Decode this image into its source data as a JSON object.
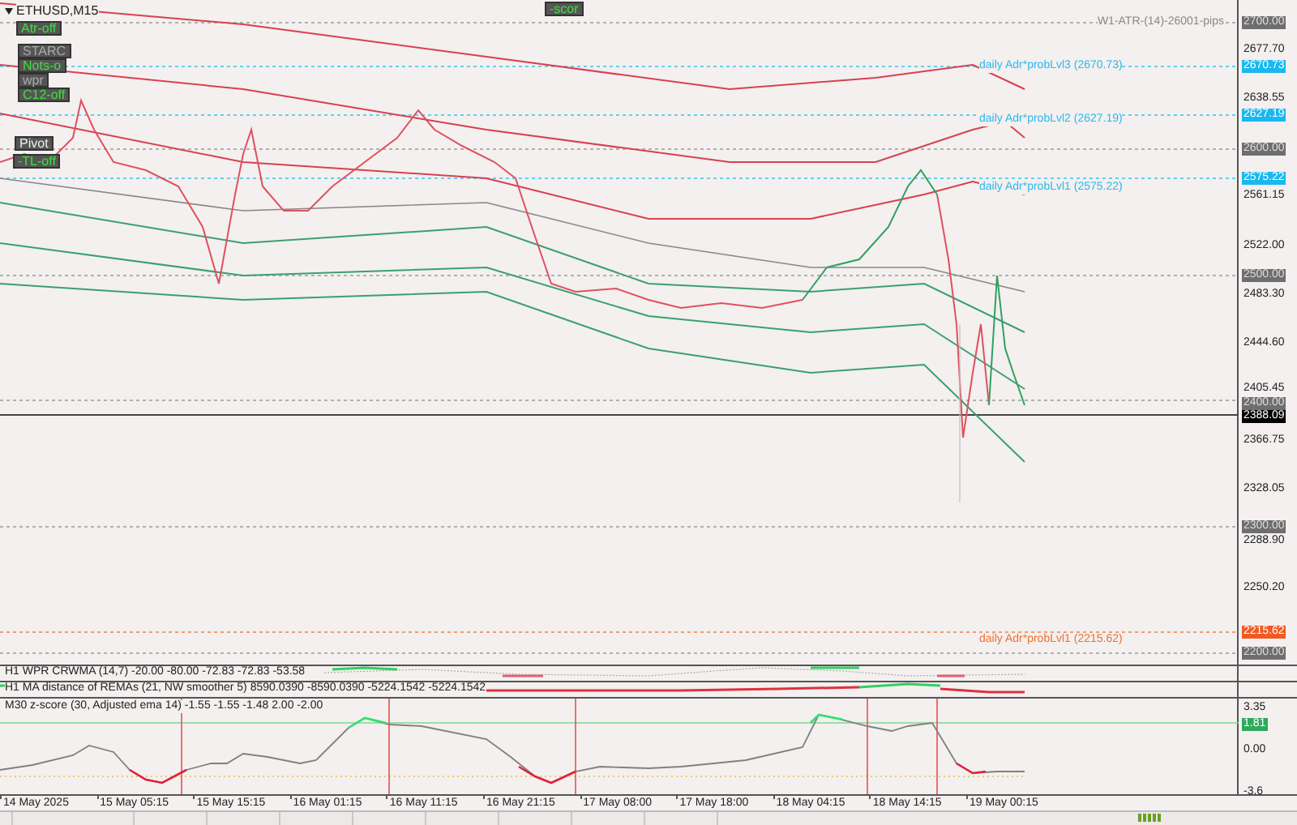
{
  "chart": {
    "symbol": "ETHUSD,M15",
    "buttons": [
      {
        "label": "Atr-off",
        "kind": "toggle"
      },
      {
        "label": "STARC",
        "kind": "caption"
      },
      {
        "label": "Nots-o",
        "kind": "toggle"
      },
      {
        "label": "wpr",
        "kind": "caption"
      },
      {
        "label": "C12-off",
        "kind": "toggle"
      },
      {
        "label": "Pivot",
        "kind": "button"
      },
      {
        "label": "-TL-off",
        "kind": "toggle"
      },
      {
        "label": "-scor",
        "kind": "toggle"
      }
    ],
    "level_labels": [
      {
        "text": "W1-ATR-(14)-26001-pips",
        "kind": "info"
      },
      {
        "text": "daily Adr*probLvl3 (2670.73)",
        "kind": "upper"
      },
      {
        "text": "daily Adr*probLvl2 (2627.19)",
        "kind": "upper"
      },
      {
        "text": "daily Adr*probLvl1 (2575.22)",
        "kind": "upper"
      },
      {
        "text": "daily Adr*probLvl1 (2215.62)",
        "kind": "lower"
      }
    ]
  },
  "price_axis": [
    {
      "text": "2700.00",
      "kind": "round"
    },
    {
      "text": "2677.70",
      "kind": "tick"
    },
    {
      "text": "2670.73",
      "kind": "upper"
    },
    {
      "text": "2638.55",
      "kind": "tick"
    },
    {
      "text": "2627.19",
      "kind": "upper"
    },
    {
      "text": "2600.00",
      "kind": "round"
    },
    {
      "text": "2575.22",
      "kind": "upper"
    },
    {
      "text": "2561.15",
      "kind": "tick"
    },
    {
      "text": "2522.00",
      "kind": "tick"
    },
    {
      "text": "2500.00",
      "kind": "round"
    },
    {
      "text": "2483.30",
      "kind": "tick"
    },
    {
      "text": "2444.60",
      "kind": "tick"
    },
    {
      "text": "2405.45",
      "kind": "tick"
    },
    {
      "text": "2400.00",
      "kind": "round"
    },
    {
      "text": "2388.09",
      "kind": "current"
    },
    {
      "text": "2366.75",
      "kind": "tick"
    },
    {
      "text": "2328.05",
      "kind": "tick"
    },
    {
      "text": "2300.00",
      "kind": "round"
    },
    {
      "text": "2288.90",
      "kind": "tick"
    },
    {
      "text": "2250.20",
      "kind": "tick"
    },
    {
      "text": "2215.62",
      "kind": "lower"
    },
    {
      "text": "2200.00",
      "kind": "round"
    }
  ],
  "indicators": [
    {
      "title": "H1 WPR CRWMA (14,7) -20.00 -80.00 -72.83 -72.83 -53.58"
    },
    {
      "title": "H1 MA distance of REMAs (21, NW smoother 5) 8590.0390 -8590.0390 -5224.1542 -5224.1542"
    },
    {
      "title": "M30 z-score (30, Adjusted ema 14) -1.55 -1.55 -1.48 2.00 -2.00"
    }
  ],
  "zscore_axis": [
    {
      "text": "3.35",
      "kind": "tick"
    },
    {
      "text": "1.81",
      "kind": "level"
    },
    {
      "text": "0.00",
      "kind": "tick"
    },
    {
      "text": "-3.6",
      "kind": "tick"
    }
  ],
  "time_axis": [
    "14 May 2025",
    "15 May 05:15",
    "15 May 15:15",
    "16 May 01:15",
    "16 May 11:15",
    "16 May 21:15",
    "17 May 08:00",
    "17 May 18:00",
    "18 May 04:15",
    "18 May 14:15",
    "19 May 00:15"
  ]
}
